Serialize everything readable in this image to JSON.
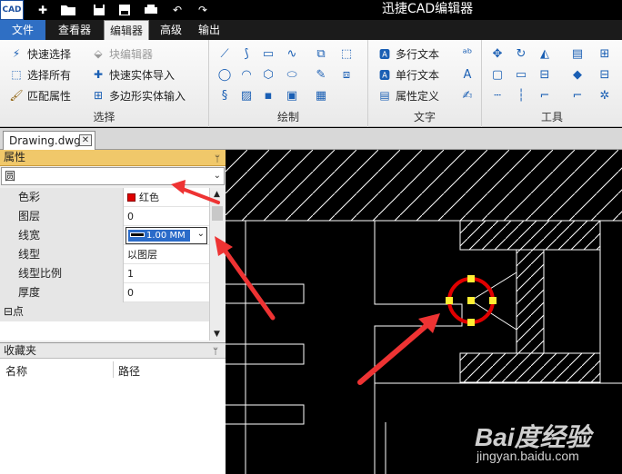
{
  "app": {
    "logo_text": "CAD",
    "title": "迅捷CAD编辑器"
  },
  "menu": {
    "tabs": [
      "文件",
      "查看器",
      "编辑器",
      "高级",
      "输出"
    ]
  },
  "ribbon": {
    "select_group": {
      "label": "选择",
      "items": [
        "快速选择",
        "选择所有",
        "匹配属性",
        "块编辑器",
        "快速实体导入",
        "多边形实体输入"
      ]
    },
    "draw_group": {
      "label": "绘制"
    },
    "text_group": {
      "label": "文字",
      "items": [
        "多行文本",
        "单行文本",
        "属性定义"
      ]
    },
    "tools_group": {
      "label": "工具"
    }
  },
  "document": {
    "tab_name": "Drawing.dwg",
    "close": "✕"
  },
  "properties": {
    "header": "属性",
    "pin": "ᛘ",
    "object_type": "圆",
    "rows": [
      {
        "name": "色彩",
        "value": "红色"
      },
      {
        "name": "图层",
        "value": "0"
      },
      {
        "name": "线宽",
        "value": "1.00 MM"
      },
      {
        "name": "线型",
        "value": "以图层"
      },
      {
        "name": "线型比例",
        "value": "1"
      },
      {
        "name": "厚度",
        "value": "0"
      }
    ],
    "category": "⊟点",
    "color_hex": "#e00000"
  },
  "favorites": {
    "header": "收藏夹",
    "pin": "ᛘ",
    "columns": [
      "名称",
      "路径"
    ]
  },
  "watermark": {
    "line1": "Bai度经验",
    "line2": "jingyan.baidu.com"
  }
}
